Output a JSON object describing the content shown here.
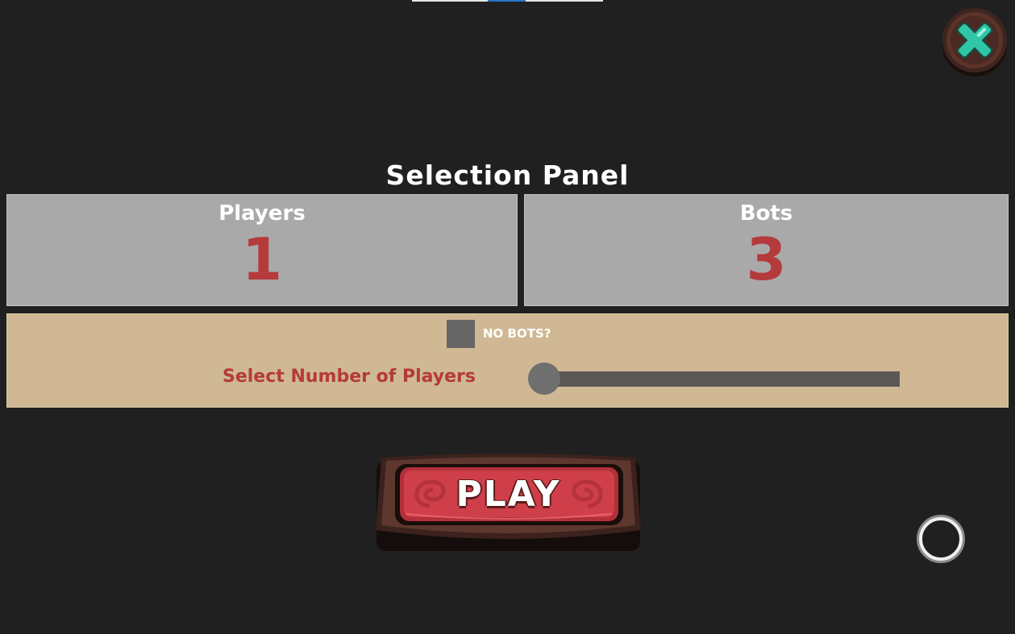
{
  "panel": {
    "title": "Selection Panel"
  },
  "counts": {
    "players_label": "Players",
    "players_value": "1",
    "bots_label": "Bots",
    "bots_value": "3"
  },
  "options": {
    "no_bots_label": "NO BOTS?",
    "no_bots_checked": false,
    "slider_label": "Select Number of Players",
    "slider_fraction": 0
  },
  "play_label": "PLAY",
  "icons": {
    "close": "close-x-icon",
    "ring": "circle-ring-icon"
  },
  "colors": {
    "background": "#202020",
    "card": "#a9a9a9",
    "panel": "#cfb893",
    "accent_red": "#b53a3c",
    "close_teal": "#2fc7a8"
  }
}
